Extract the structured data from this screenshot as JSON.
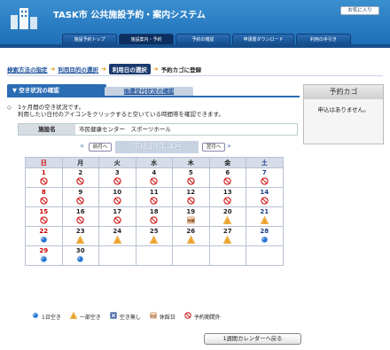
{
  "header": {
    "title": "TASK市 公共施設予約・案内システム",
    "favorite_label": "お気に入り",
    "nav": [
      {
        "label": "施設予約トップ"
      },
      {
        "label": "施設案内・予約"
      },
      {
        "label": "予約の確認"
      },
      {
        "label": "申請書ダウンロード"
      },
      {
        "label": "利用の手引き"
      }
    ]
  },
  "steps": [
    {
      "label": "検索方法の指定"
    },
    {
      "label": "利用目的の選択"
    },
    {
      "label": "利用日の選択"
    },
    {
      "label": "予約カゴに登録"
    }
  ],
  "tabs": {
    "availability": "空き状況の確認",
    "reception": "抽選受付状況の確認"
  },
  "cart": {
    "title": "予約カゴ",
    "message": "申込はありません。"
  },
  "info": {
    "line1": "1ヶ月間の空き状況です。",
    "line2": "利用したい日付のアイコンをクリックすると空いている時間帯を確認できます。"
  },
  "facility": {
    "label": "施設名",
    "value": "市民健康センター　スポーツホール"
  },
  "month": {
    "title": "平成19年 4月",
    "prev_label": "前月へ",
    "next_label": "翌月へ"
  },
  "weekdays": [
    "日",
    "月",
    "火",
    "水",
    "木",
    "金",
    "土"
  ],
  "calendar": [
    [
      {
        "d": "1",
        "s": "out"
      },
      {
        "d": "2",
        "s": "out"
      },
      {
        "d": "3",
        "s": "out"
      },
      {
        "d": "4",
        "s": "out"
      },
      {
        "d": "5",
        "s": "out"
      },
      {
        "d": "6",
        "s": "out"
      },
      {
        "d": "7",
        "s": "out"
      }
    ],
    [
      {
        "d": "8",
        "s": "out"
      },
      {
        "d": "9",
        "s": "out"
      },
      {
        "d": "10",
        "s": "out"
      },
      {
        "d": "11",
        "s": "out"
      },
      {
        "d": "12",
        "s": "out"
      },
      {
        "d": "13",
        "s": "out"
      },
      {
        "d": "14",
        "s": "out"
      }
    ],
    [
      {
        "d": "15",
        "s": "out"
      },
      {
        "d": "16",
        "s": "out"
      },
      {
        "d": "17",
        "s": "out"
      },
      {
        "d": "18",
        "s": "out"
      },
      {
        "d": "19",
        "s": "closed"
      },
      {
        "d": "20",
        "s": "partial"
      },
      {
        "d": "21",
        "s": "partial"
      }
    ],
    [
      {
        "d": "22",
        "s": "available"
      },
      {
        "d": "23",
        "s": "partial"
      },
      {
        "d": "24",
        "s": "partial"
      },
      {
        "d": "25",
        "s": "partial"
      },
      {
        "d": "26",
        "s": "partial"
      },
      {
        "d": "27",
        "s": "partial"
      },
      {
        "d": "28",
        "s": "available"
      }
    ],
    [
      {
        "d": "29",
        "s": "available"
      },
      {
        "d": "30",
        "s": "available"
      },
      {
        "d": "",
        "s": ""
      },
      {
        "d": "",
        "s": ""
      },
      {
        "d": "",
        "s": ""
      },
      {
        "d": "",
        "s": ""
      },
      {
        "d": "",
        "s": ""
      }
    ]
  ],
  "icon_labels": {
    "closed": "休館"
  },
  "legend": [
    {
      "kind": "available",
      "label": "1日空き"
    },
    {
      "kind": "partial",
      "label": "一部空き"
    },
    {
      "kind": "full",
      "label": "空き無し"
    },
    {
      "kind": "closed",
      "label": "休館日"
    },
    {
      "kind": "out",
      "label": "予約期間外"
    }
  ],
  "week_button": "1週間カレンダーへ戻る",
  "colors": {
    "header_blue": "#2a6db5",
    "sunday": "#cc0000",
    "saturday": "#1a3a8a",
    "available": "#1f6fd0",
    "partial": "#e89a20",
    "out": "#d02020"
  }
}
